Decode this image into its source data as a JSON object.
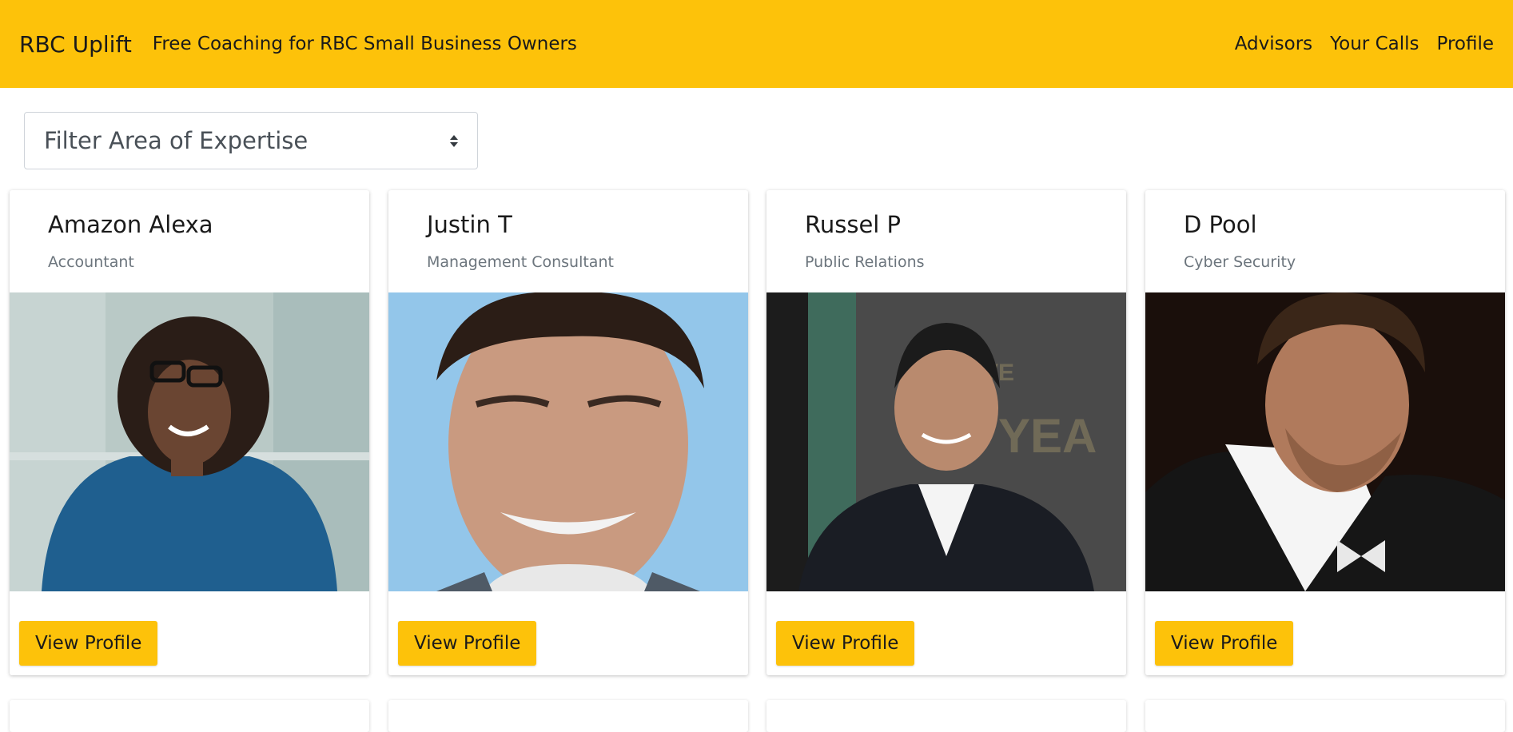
{
  "header": {
    "brand": "RBC Uplift",
    "tagline": "Free Coaching for RBC Small Business Owners",
    "nav": [
      "Advisors",
      "Your Calls",
      "Profile"
    ]
  },
  "filter": {
    "label": "Filter Area of Expertise"
  },
  "advisors": [
    {
      "name": "Amazon Alexa",
      "role": "Accountant",
      "button": "View Profile"
    },
    {
      "name": "Justin T",
      "role": "Management Consultant",
      "button": "View Profile"
    },
    {
      "name": "Russel P",
      "role": "Public Relations",
      "button": "View Profile"
    },
    {
      "name": "D Pool",
      "role": "Cyber Security",
      "button": "View Profile"
    }
  ],
  "colors": {
    "accent": "#fdc20a",
    "muted_text": "#6c757d"
  }
}
